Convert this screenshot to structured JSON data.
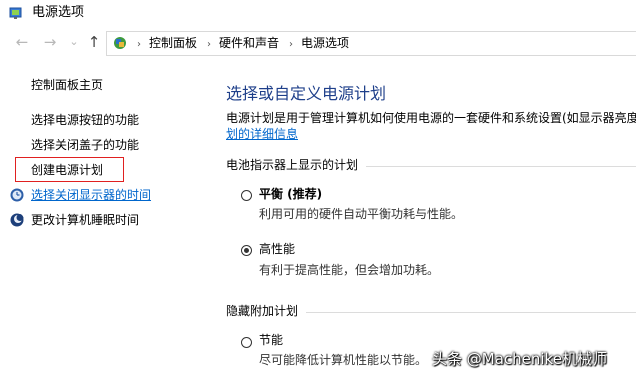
{
  "window": {
    "title": "电源选项"
  },
  "nav": {
    "back": "←",
    "forward": "→",
    "dropdown": "⌄",
    "up": "↑"
  },
  "breadcrumb": {
    "items": [
      "控制面板",
      "硬件和声音",
      "电源选项"
    ],
    "separator": "›"
  },
  "sidebar": {
    "home": "控制面板主页",
    "items": [
      {
        "label": "选择电源按钮的功能"
      },
      {
        "label": "选择关闭盖子的功能"
      },
      {
        "label": "创建电源计划"
      },
      {
        "label": "选择关闭显示器的时间"
      },
      {
        "label": "更改计算机睡眠时间"
      }
    ]
  },
  "main": {
    "heading": "选择或自定义电源计划",
    "description": "电源计划是用于管理计算机如何使用电源的一套硬件和系统设置(如显示器亮度",
    "description_link": "划的详细信息",
    "battery_section": "电池指示器上显示的计划",
    "plans": [
      {
        "name": "平衡 (推荐)",
        "desc": "利用可用的硬件自动平衡功耗与性能。",
        "selected": false
      },
      {
        "name": "高性能",
        "desc": "有利于提高性能，但会增加功耗。",
        "selected": true
      }
    ],
    "hidden_section": "隐藏附加计划",
    "hidden_plans": [
      {
        "name": "节能",
        "desc": "尽可能降低计算机性能以节能。",
        "selected": false
      }
    ]
  },
  "watermark": "头条 @Machenike机械师",
  "colors": {
    "link": "#0066cc",
    "heading": "#1e3f8a",
    "highlight_box": "#e02020"
  },
  "icons": {
    "app": "power-options-icon",
    "breadcrumb": "control-panel-icon",
    "display": "display-clock-icon",
    "sleep": "moon-icon"
  }
}
